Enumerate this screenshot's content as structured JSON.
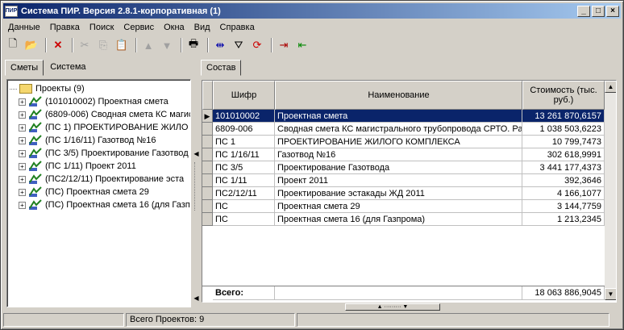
{
  "window": {
    "title": "Система ПИР. Версия 2.8.1-корпоративная (1)",
    "app_icon_text": "ПИР"
  },
  "menu": [
    "Данные",
    "Правка",
    "Поиск",
    "Сервис",
    "Окна",
    "Вид",
    "Справка"
  ],
  "toolbar_icons": [
    "new-document-icon",
    "open-folder-icon",
    "delete-icon",
    "cut-icon",
    "copy-icon",
    "paste-icon",
    "move-up-icon",
    "move-down-icon",
    "print-icon",
    "column-setup-icon",
    "filter-icon",
    "refresh-icon",
    "export-icon",
    "import-icon"
  ],
  "left_tabs": [
    "Сметы",
    "Система"
  ],
  "tree": {
    "root": "Проекты (9)",
    "items": [
      "(101010002) Проектная смета",
      "(6809-006) Сводная смета КС  магис",
      "(ПС 1) ПРОЕКТИРОВАНИЕ ЖИЛО",
      "(ПС 1/16/11) Газотвод №16",
      "(ПС 3/5) Проектирование Газотвод",
      "(ПС 1/11) Проект 2011",
      "(ПС2/12/11) Проектирование эста",
      "(ПС) Проектная смета 29",
      "(ПС) Проектная смета 16 (для Газп"
    ]
  },
  "right_tab": "Состав",
  "table": {
    "headers": {
      "code": "Шифр",
      "name": "Наименование",
      "cost": "Стоимость (тыс. руб.)"
    },
    "rows": [
      {
        "code": "101010002",
        "name": "Проектная смета",
        "cost": "13 261 870,6157",
        "selected": true
      },
      {
        "code": "6809-006",
        "name": "Сводная смета КС  магистрального трубопровода СРТО. Раб",
        "cost": "1 038 503,6223"
      },
      {
        "code": "ПС 1",
        "name": "ПРОЕКТИРОВАНИЕ ЖИЛОГО КОМПЛЕКСА",
        "cost": "10 799,7473"
      },
      {
        "code": "ПС 1/16/11",
        "name": "Газотвод №16",
        "cost": "302 618,9991"
      },
      {
        "code": "ПС 3/5",
        "name": "Проектирование Газотвода",
        "cost": "3 441 177,4373"
      },
      {
        "code": "ПС 1/11",
        "name": "Проект 2011",
        "cost": "392,3646"
      },
      {
        "code": "ПС2/12/11",
        "name": "Проектирование эстакады ЖД 2011",
        "cost": "4 166,1077"
      },
      {
        "code": "ПС",
        "name": "Проектная смета 29",
        "cost": "3 144,7759"
      },
      {
        "code": "ПС",
        "name": "Проектная смета 16 (для Газпрома)",
        "cost": "1 213,2345"
      }
    ],
    "total_label": "Всего:",
    "total_value": "18 063 886,9045"
  },
  "status": {
    "projects_count": "Всего Проектов: 9"
  }
}
